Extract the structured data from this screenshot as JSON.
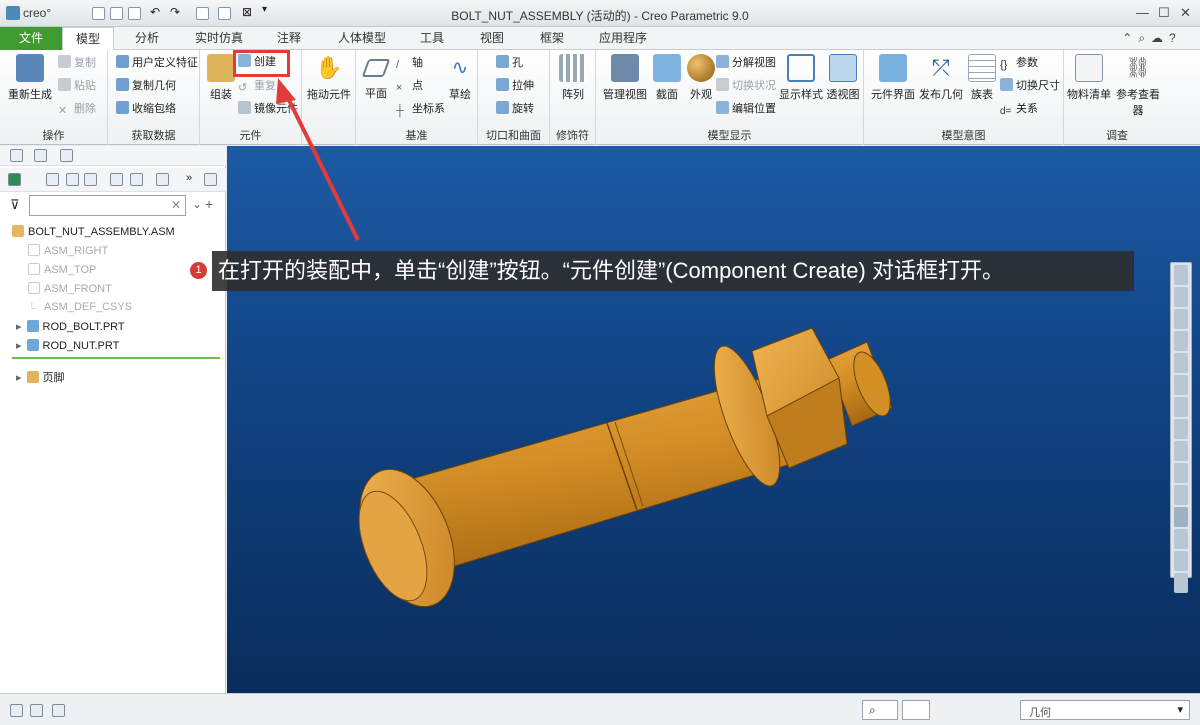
{
  "window": {
    "logo": "creo°",
    "title": "BOLT_NUT_ASSEMBLY (活动的) - Creo Parametric 9.0"
  },
  "tabs": [
    "文件",
    "模型",
    "分析",
    "实时仿真",
    "注释",
    "人体模型",
    "工具",
    "视图",
    "框架",
    "应用程序"
  ],
  "ribbon": {
    "ops": {
      "regen": "重新生成",
      "copy": "复制",
      "paste": "粘贴",
      "delete": "删除",
      "label": "操作"
    },
    "get": {
      "udf": "用户定义特征",
      "copygeom": "复制几何",
      "shrink": "收缩包络",
      "label": "获取数据"
    },
    "comp": {
      "assemble": "组装",
      "create": "创建",
      "repeat": "重复",
      "mirror": "镜像元件",
      "label": "元件"
    },
    "drag": {
      "label": "拖动元件"
    },
    "datum": {
      "plane": "平面",
      "axis": "轴",
      "point": "点",
      "csys": "坐标系",
      "sketch": "草绘",
      "label": "基准"
    },
    "cut": {
      "hole": "孔",
      "extrude": "拉伸",
      "revolve": "旋转",
      "label": "切口和曲面"
    },
    "mod": {
      "pattern": "阵列",
      "label": "修饰符"
    },
    "disp": {
      "manage": "管理视图",
      "section": "截面",
      "appearance": "外观",
      "explode": "分解视图",
      "toggle": "切换状况",
      "editpos": "编辑位置",
      "style": "显示样式",
      "perspective": "透视图",
      "label": "模型显示"
    },
    "intent": {
      "interface": "元件界面",
      "publish": "发布几何",
      "family": "族表",
      "params": "参数",
      "switchdim": "切换尺寸",
      "relations": "关系",
      "label": "模型意图"
    },
    "investigate": {
      "bom": "物料清单",
      "refviewer": "参考查看器",
      "label": "调查"
    }
  },
  "tree": {
    "root": "BOLT_NUT_ASSEMBLY.ASM",
    "items": [
      "ASM_RIGHT",
      "ASM_TOP",
      "ASM_FRONT",
      "ASM_DEF_CSYS",
      "ROD_BOLT.PRT",
      "ROD_NUT.PRT"
    ],
    "footer": "页脚"
  },
  "callout": {
    "badge": "1",
    "text": "在打开的装配中，单击“创建”按钮。“元件创建”(Component Create) 对话框打开。"
  },
  "status": {
    "filter": "几何"
  },
  "colors": {
    "file_tab": "#3f9a2f",
    "model": "#d9962f",
    "highlight": "#e23b3b",
    "viewport_top": "#1c5aa5",
    "viewport_bottom": "#0a2c5b"
  }
}
